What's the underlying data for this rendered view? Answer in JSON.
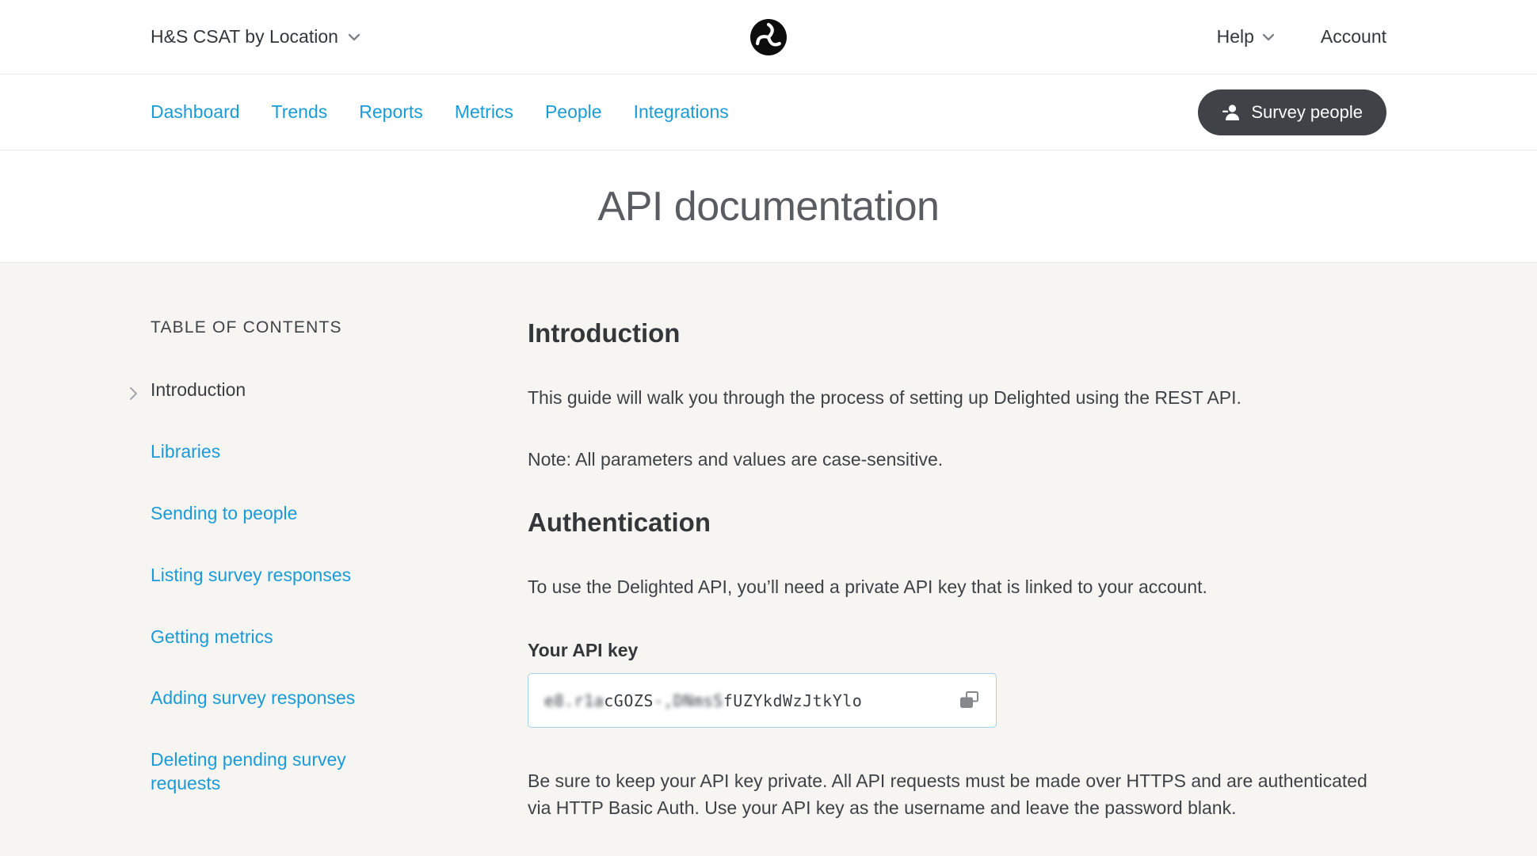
{
  "header": {
    "project_selector": "H&S CSAT by Location",
    "help": "Help",
    "account": "Account"
  },
  "nav": {
    "items": [
      {
        "label": "Dashboard"
      },
      {
        "label": "Trends"
      },
      {
        "label": "Reports"
      },
      {
        "label": "Metrics"
      },
      {
        "label": "People"
      },
      {
        "label": "Integrations"
      }
    ],
    "survey_button": "Survey people"
  },
  "page": {
    "title": "API documentation"
  },
  "toc": {
    "heading": "TABLE OF CONTENTS",
    "items": [
      {
        "label": "Introduction",
        "active": true
      },
      {
        "label": "Libraries",
        "active": false
      },
      {
        "label": "Sending to people",
        "active": false
      },
      {
        "label": "Listing survey responses",
        "active": false
      },
      {
        "label": "Getting metrics",
        "active": false
      },
      {
        "label": "Adding survey responses",
        "active": false
      },
      {
        "label": "Deleting pending survey requests",
        "active": false
      }
    ]
  },
  "content": {
    "intro_heading": "Introduction",
    "intro_p1": "This guide will walk you through the process of setting up Delighted using the REST API.",
    "intro_p2": "Note: All parameters and values are case-sensitive.",
    "auth_heading": "Authentication",
    "auth_p1": "To use the Delighted API, you’ll need a private API key that is linked to your account.",
    "api_key_label": "Your API key",
    "api_key": {
      "seg1_obscured": "e8.r1a",
      "seg2": "cGOZS",
      "seg3_obscured": "-,DNmsS",
      "seg4": "fUZYkdWzJtkYlo"
    },
    "auth_p2": "Be sure to keep your API key private. All API requests must be made over HTTPS and are authenticated via HTTP Basic Auth. Use your API key as the username and leave the password blank."
  },
  "colors": {
    "accent_blue": "#1a9bd7",
    "dark_text": "#33373a",
    "button_dark": "#3f4347",
    "content_background": "#f7f5f2",
    "api_key_border": "#9fd2ec"
  }
}
